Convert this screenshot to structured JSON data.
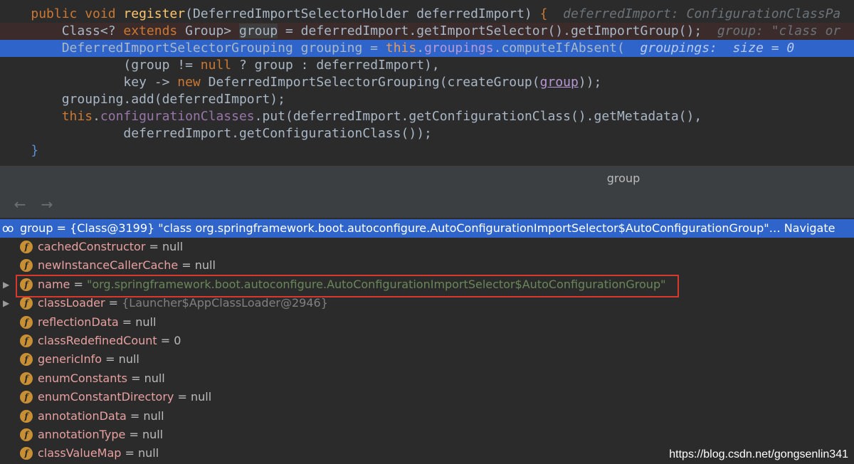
{
  "editor": {
    "line1": {
      "kw1": "public void ",
      "fn": "register",
      "p1": "(DeferredImportSelectorHolder deferredImport) ",
      "brace": "{",
      "hint": "  deferredImport: ConfigurationClassPa"
    },
    "line2": {
      "t1": "Class<? ",
      "kw": "extends",
      "t2": " Group> ",
      "var": "group",
      "t3": " = deferredImport.getImportSelector().getImportGroup();",
      "hint": "  group: \"class or"
    },
    "line3": {
      "t1": "DeferredImportSelectorGrouping grouping = ",
      "kw": "this",
      "dot": ".",
      "fld": "groupings",
      "t2": ".computeIfAbsent(",
      "hint": "  groupings:  size = 0"
    },
    "line4": {
      "t1": "(group != ",
      "kw": "null",
      "t2": " ? group : deferredImport),"
    },
    "line5": {
      "t1": "key -> ",
      "kw": "new",
      "t2": " DeferredImportSelectorGrouping(createGroup(",
      "var": "group",
      "t3": "));"
    },
    "line6": {
      "t1": "grouping.add(deferredImport);"
    },
    "line7": {
      "kw": "this",
      "dot": ".",
      "fld": "configurationClasses",
      "t1": ".put(deferredImport.getConfigurationClass().getMetadata(),"
    },
    "line8": {
      "t1": "deferredImport.getConfigurationClass());"
    },
    "line9": {
      "t1": "}"
    }
  },
  "debug_panel": {
    "title": "group",
    "toolbar": {
      "back": "←",
      "forward": "→"
    }
  },
  "variables": {
    "root": {
      "icon": "oo",
      "name": "group",
      "value": " = {Class@3199} \"class org.springframework.boot.autoconfigure.AutoConfigurationImportSelector$AutoConfigurationGroup\"…",
      "navigate": "Navigate"
    },
    "fields": [
      {
        "name": "cachedConstructor",
        "eq": " = ",
        "value": "null",
        "type": "null",
        "expandable": false
      },
      {
        "name": "newInstanceCallerCache",
        "eq": " = ",
        "value": "null",
        "type": "null",
        "expandable": false
      },
      {
        "name": "name",
        "eq": " = ",
        "value": "\"org.springframework.boot.autoconfigure.AutoConfigurationImportSelector$AutoConfigurationGroup\"",
        "type": "str",
        "expandable": true
      },
      {
        "name": "classLoader",
        "eq": " = ",
        "value": "{Launcher$AppClassLoader@2946}",
        "type": "obj",
        "expandable": true
      },
      {
        "name": "reflectionData",
        "eq": " = ",
        "value": "null",
        "type": "null",
        "expandable": false
      },
      {
        "name": "classRedefinedCount",
        "eq": " = ",
        "value": "0",
        "type": "null",
        "expandable": false
      },
      {
        "name": "genericInfo",
        "eq": " = ",
        "value": "null",
        "type": "null",
        "expandable": false
      },
      {
        "name": "enumConstants",
        "eq": " = ",
        "value": "null",
        "type": "null",
        "expandable": false
      },
      {
        "name": "enumConstantDirectory",
        "eq": " = ",
        "value": "null",
        "type": "null",
        "expandable": false
      },
      {
        "name": "annotationData",
        "eq": " = ",
        "value": "null",
        "type": "null",
        "expandable": false
      },
      {
        "name": "annotationType",
        "eq": " = ",
        "value": "null",
        "type": "null",
        "expandable": false
      },
      {
        "name": "classValueMap",
        "eq": " = ",
        "value": "null",
        "type": "null",
        "expandable": false
      }
    ],
    "field_badge": "f",
    "expand_glyph": "▶"
  },
  "watermark": "https://blog.csdn.net/gongsenlin341",
  "colors": {
    "editor_bg": "#2b2b2b",
    "selection": "#2f65ca",
    "keyword": "#cc7832",
    "method": "#ffc66d",
    "field": "#9876aa",
    "string": "#6a8759",
    "highlight_border": "#d9382c"
  }
}
